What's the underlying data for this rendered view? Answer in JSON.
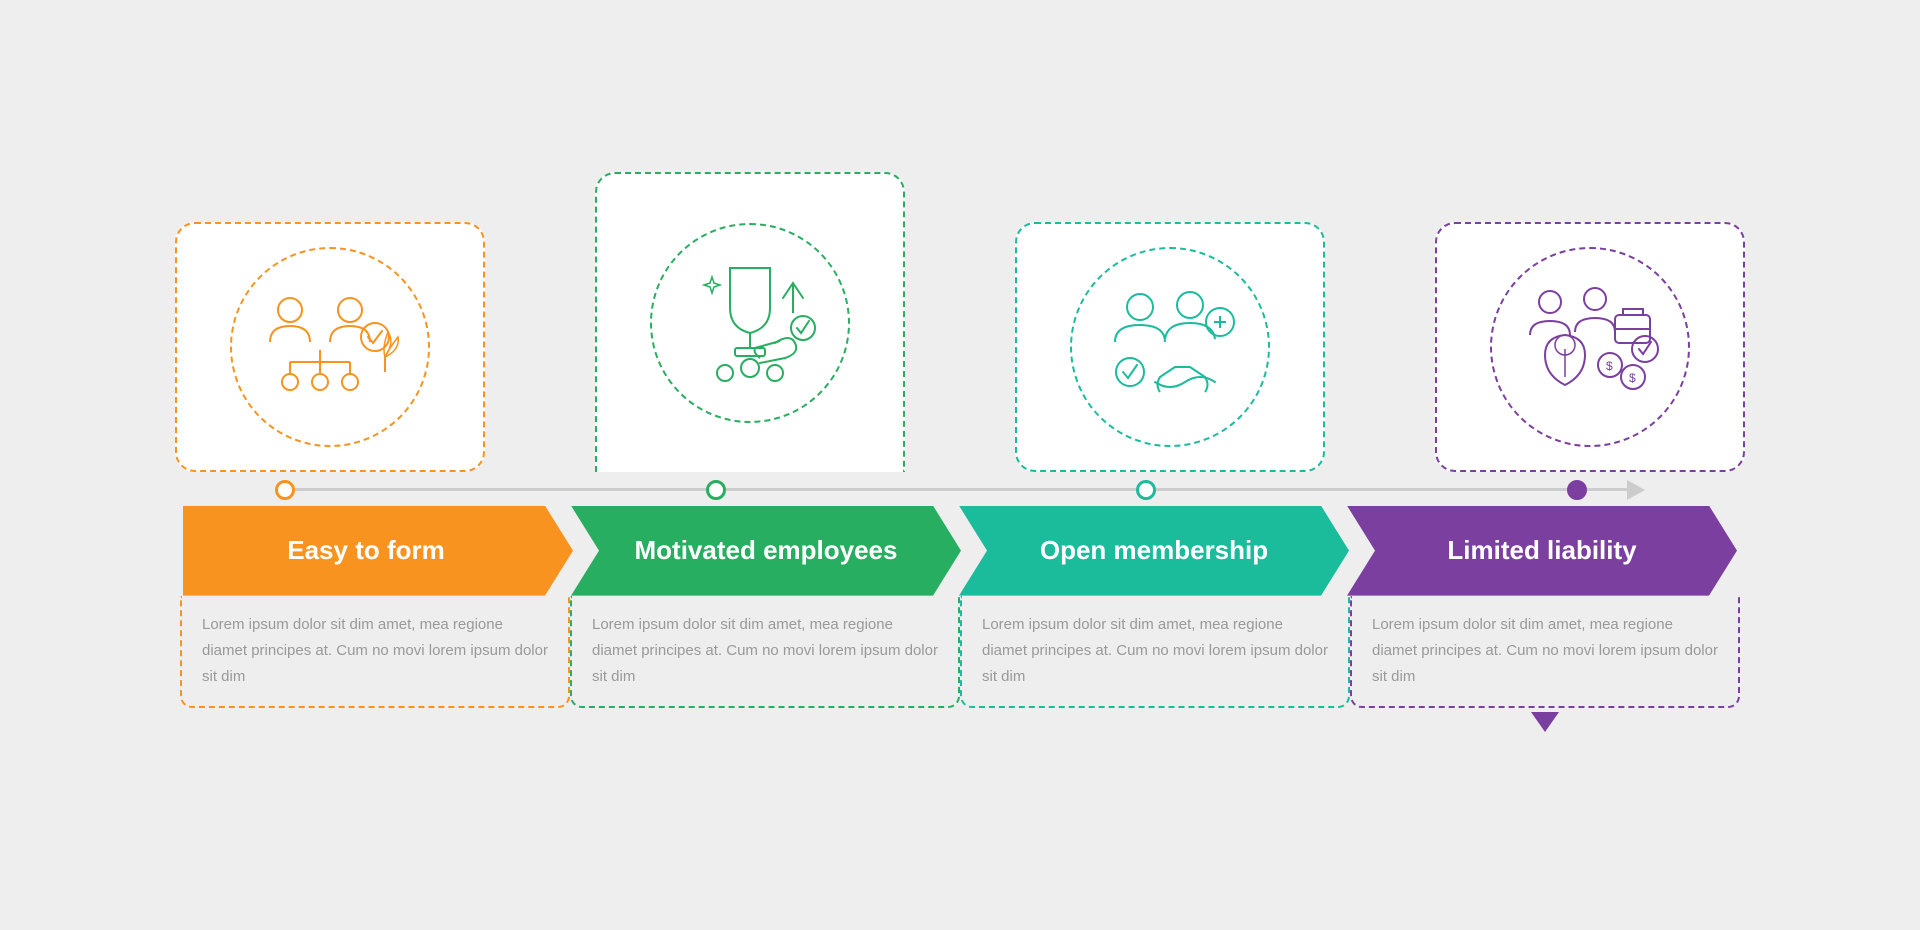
{
  "infographic": {
    "items": [
      {
        "id": "item1",
        "label": "Easy to form",
        "color": "#F7931E",
        "colorClass": "orange",
        "dotClass": "dot-orange",
        "textClass": "text-block-1",
        "cardClass": "card-1",
        "isSecond": false,
        "description": "Lorem ipsum dolor sit dim amet, mea regione diamet principes at. Cum no movi lorem ipsum dolor sit dim",
        "icon": "organization"
      },
      {
        "id": "item2",
        "label": "Motivated employees",
        "color": "#27AE60",
        "colorClass": "green",
        "dotClass": "dot-green",
        "textClass": "text-block-2",
        "cardClass": "card-2",
        "isSecond": true,
        "description": "Lorem ipsum dolor sit dim amet, mea regione diamet principes at. Cum no movi lorem ipsum dolor sit dim",
        "icon": "reward"
      },
      {
        "id": "item3",
        "label": "Open membership",
        "color": "#1ABC9C",
        "colorClass": "teal",
        "dotClass": "dot-teal",
        "textClass": "text-block-3",
        "cardClass": "card-3",
        "isSecond": false,
        "description": "Lorem ipsum dolor sit dim amet, mea regione diamet principes at. Cum no movi lorem ipsum dolor sit dim",
        "icon": "membership"
      },
      {
        "id": "item4",
        "label": "Limited liability",
        "color": "#7B3FA0",
        "colorClass": "purple",
        "dotClass": "dot-purple",
        "textClass": "text-block-4",
        "cardClass": "card-4",
        "isSecond": false,
        "description": "Lorem ipsum dolor sit dim amet, mea regione diamet principes at. Cum no movi lorem ipsum dolor sit dim",
        "icon": "liability"
      }
    ]
  }
}
